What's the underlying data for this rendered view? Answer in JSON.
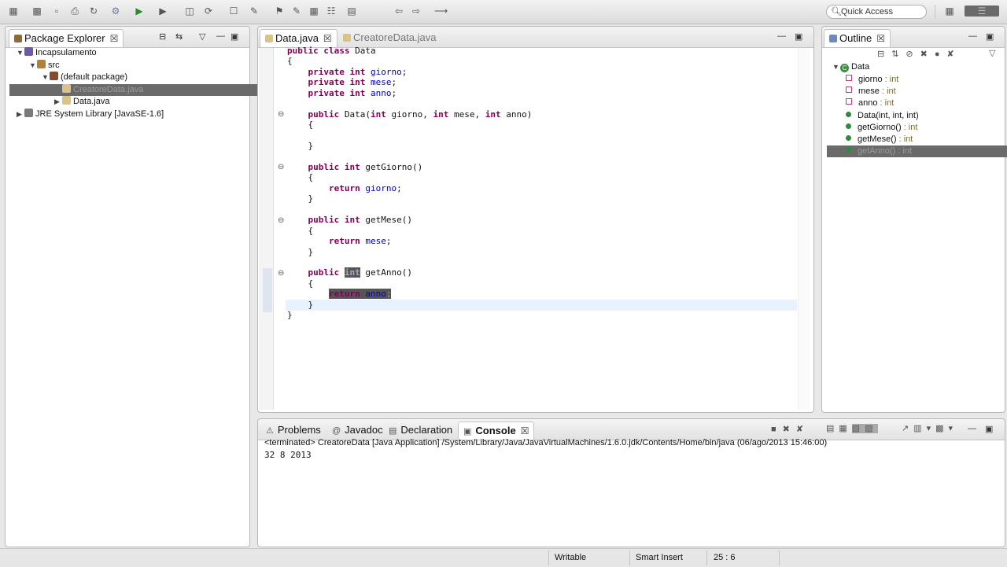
{
  "toolbar": {
    "icons": [
      "new-icon",
      "save-icon",
      "save-all-icon",
      "print-icon",
      "refresh-icon",
      "debug-icon",
      "run-icon",
      "external-tools-icon",
      "new-java-project-icon",
      "new-class-icon",
      "open-type-icon",
      "search-icon",
      "toggle-mark-icon",
      "highlight-icon",
      "open-task-icon",
      "open-perspective-icon",
      "annotation-icon",
      "back-icon",
      "forward-icon",
      "pin-icon"
    ],
    "quick_access": "Quick Access"
  },
  "package_explorer": {
    "title": "Package Explorer",
    "tree": [
      {
        "label": "Incapsulamento",
        "level": 0,
        "expanded": true,
        "icon": "project-icon"
      },
      {
        "label": "src",
        "level": 1,
        "expanded": true,
        "icon": "source-folder-icon"
      },
      {
        "label": "(default package)",
        "level": 2,
        "expanded": true,
        "icon": "package-icon"
      },
      {
        "label": "CreatoreData.java",
        "level": 3,
        "expanded": false,
        "icon": "java-file-icon",
        "selected": true
      },
      {
        "label": "Data.java",
        "level": 3,
        "expanded": false,
        "icon": "java-file-icon"
      },
      {
        "label": "JRE System Library [JavaSE-1.6]",
        "level": 0,
        "expanded": false,
        "icon": "library-icon"
      }
    ]
  },
  "editor": {
    "tabs": [
      {
        "label": "Data.java",
        "active": true
      },
      {
        "label": "CreatoreData.java",
        "active": false
      }
    ],
    "lines": [
      "public class Data",
      "{",
      "    private int giorno;",
      "    private int mese;",
      "    private int anno;",
      "",
      "    public Data(int giorno, int mese, int anno)",
      "    {",
      "",
      "    }",
      "",
      "    public int getGiorno()",
      "    {",
      "        return giorno;",
      "    }",
      "",
      "    public int getMese()",
      "    {",
      "        return mese;",
      "    }",
      "",
      "    public int getAnno()",
      "    {",
      "        return anno;",
      "    }",
      "}"
    ]
  },
  "outline": {
    "title": "Outline",
    "class_name": "Data",
    "members": [
      {
        "name": "giorno",
        "type": " : int",
        "kind": "field"
      },
      {
        "name": "mese",
        "type": " : int",
        "kind": "field"
      },
      {
        "name": "anno",
        "type": " : int",
        "kind": "field"
      },
      {
        "name": "Data(int, int, int)",
        "type": "",
        "kind": "constructor"
      },
      {
        "name": "getGiorno()",
        "type": " : int",
        "kind": "method"
      },
      {
        "name": "getMese()",
        "type": " : int",
        "kind": "method"
      },
      {
        "name": "getAnno()",
        "type": " : int",
        "kind": "method",
        "selected": true
      }
    ]
  },
  "bottom_panel": {
    "tabs": [
      {
        "label": "Problems",
        "icon": "problems-icon"
      },
      {
        "label": "Javadoc",
        "icon": "javadoc-icon"
      },
      {
        "label": "Declaration",
        "icon": "declaration-icon"
      },
      {
        "label": "Console",
        "icon": "console-icon",
        "active": true
      }
    ],
    "console_header": "<terminated> CreatoreData [Java Application] /System/Library/Java/JavaVirtualMachines/1.6.0.jdk/Contents/Home/bin/java (06/ago/2013 15:46:00)",
    "console_output": "32 8 2013"
  },
  "status": {
    "writable": "Writable",
    "insert_mode": "Smart Insert",
    "position": "25 : 6"
  }
}
